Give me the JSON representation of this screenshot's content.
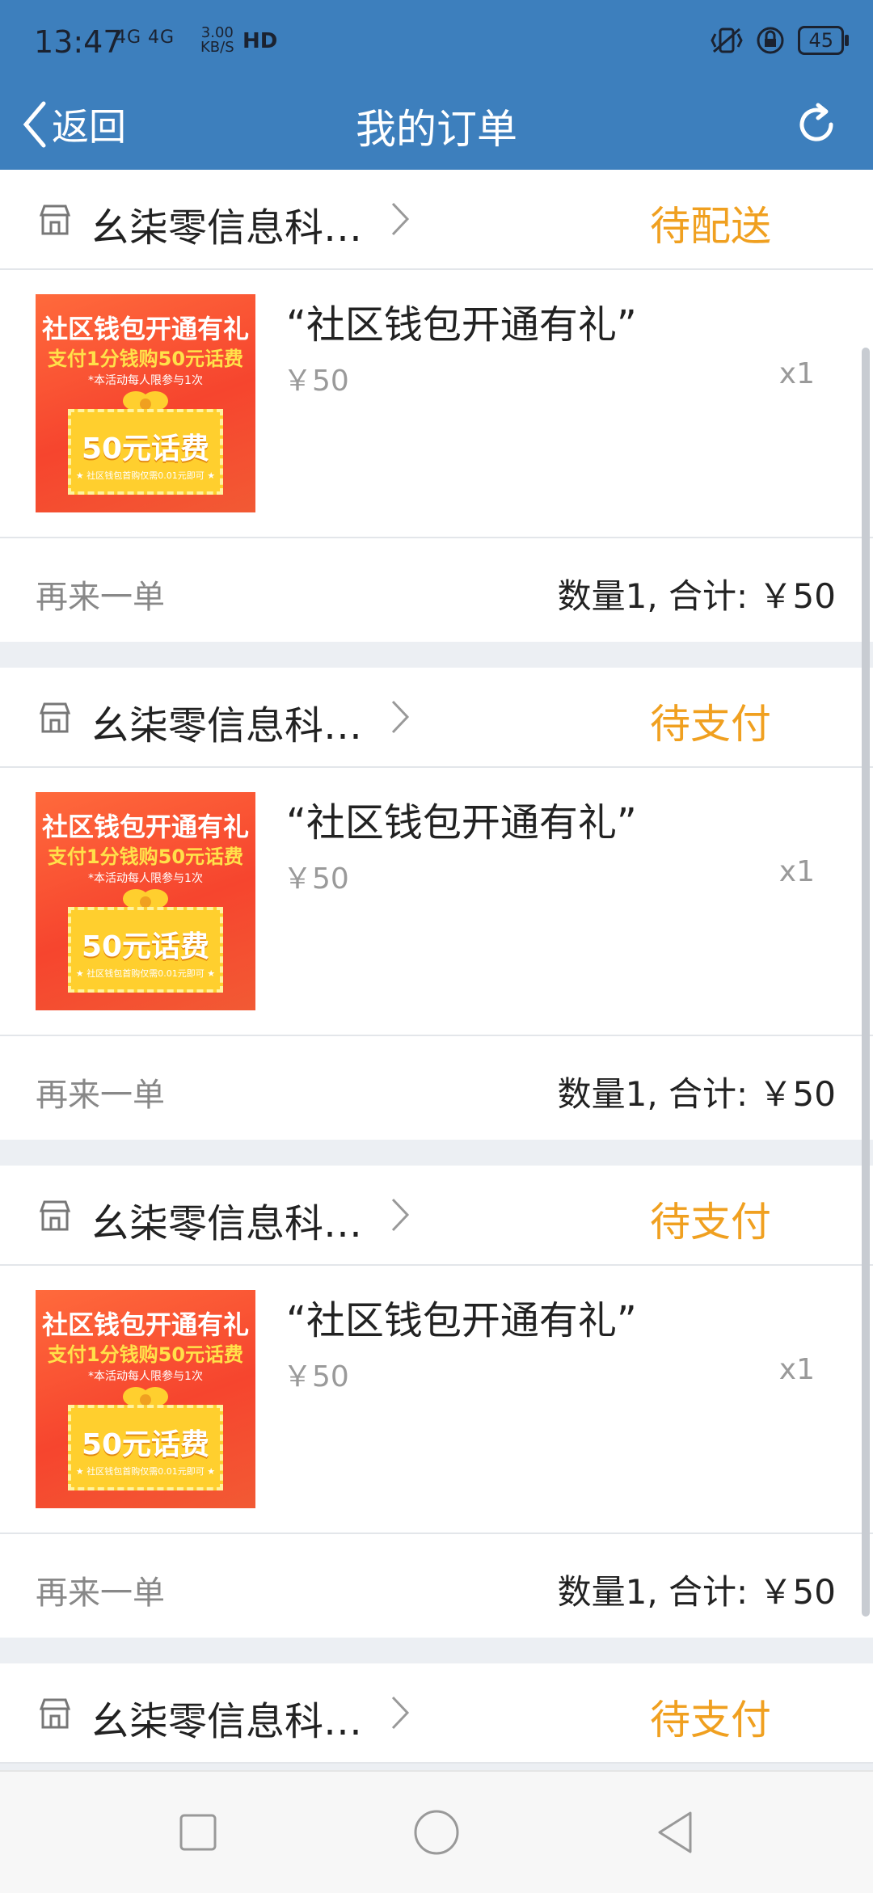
{
  "status_bar": {
    "time": "13:47",
    "network": "4G 4G",
    "speed_value": "3.00",
    "speed_unit": "KB/S",
    "hd": "HD",
    "battery": "45"
  },
  "header": {
    "back_label": "返回",
    "title": "我的订单"
  },
  "orders": [
    {
      "shop_name": "幺柒零信息科…",
      "status": "待配送",
      "product_name": "“社区钱包开通有礼”",
      "price": "￥50",
      "quantity": "x1",
      "reorder_label": "再来一单",
      "total": "数量1, 合计: ￥50"
    },
    {
      "shop_name": "幺柒零信息科…",
      "status": "待支付",
      "product_name": "“社区钱包开通有礼”",
      "price": "￥50",
      "quantity": "x1",
      "reorder_label": "再来一单",
      "total": "数量1, 合计: ￥50"
    },
    {
      "shop_name": "幺柒零信息科…",
      "status": "待支付",
      "product_name": "“社区钱包开通有礼”",
      "price": "￥50",
      "quantity": "x1",
      "reorder_label": "再来一单",
      "total": "数量1, 合计: ￥50"
    },
    {
      "shop_name": "幺柒零信息科…",
      "status": "待支付"
    }
  ],
  "product_image": {
    "title": "社区钱包开通有礼",
    "subtitle": "支付1分钱购50元话费",
    "note": "*本活动每人限参与1次",
    "box_text": "50元话费",
    "box_note": "★ 社区钱包首购仅需0.01元即可 ★"
  },
  "colors": {
    "header_bg": "#3d7fbd",
    "status_accent": "#f0a020"
  }
}
